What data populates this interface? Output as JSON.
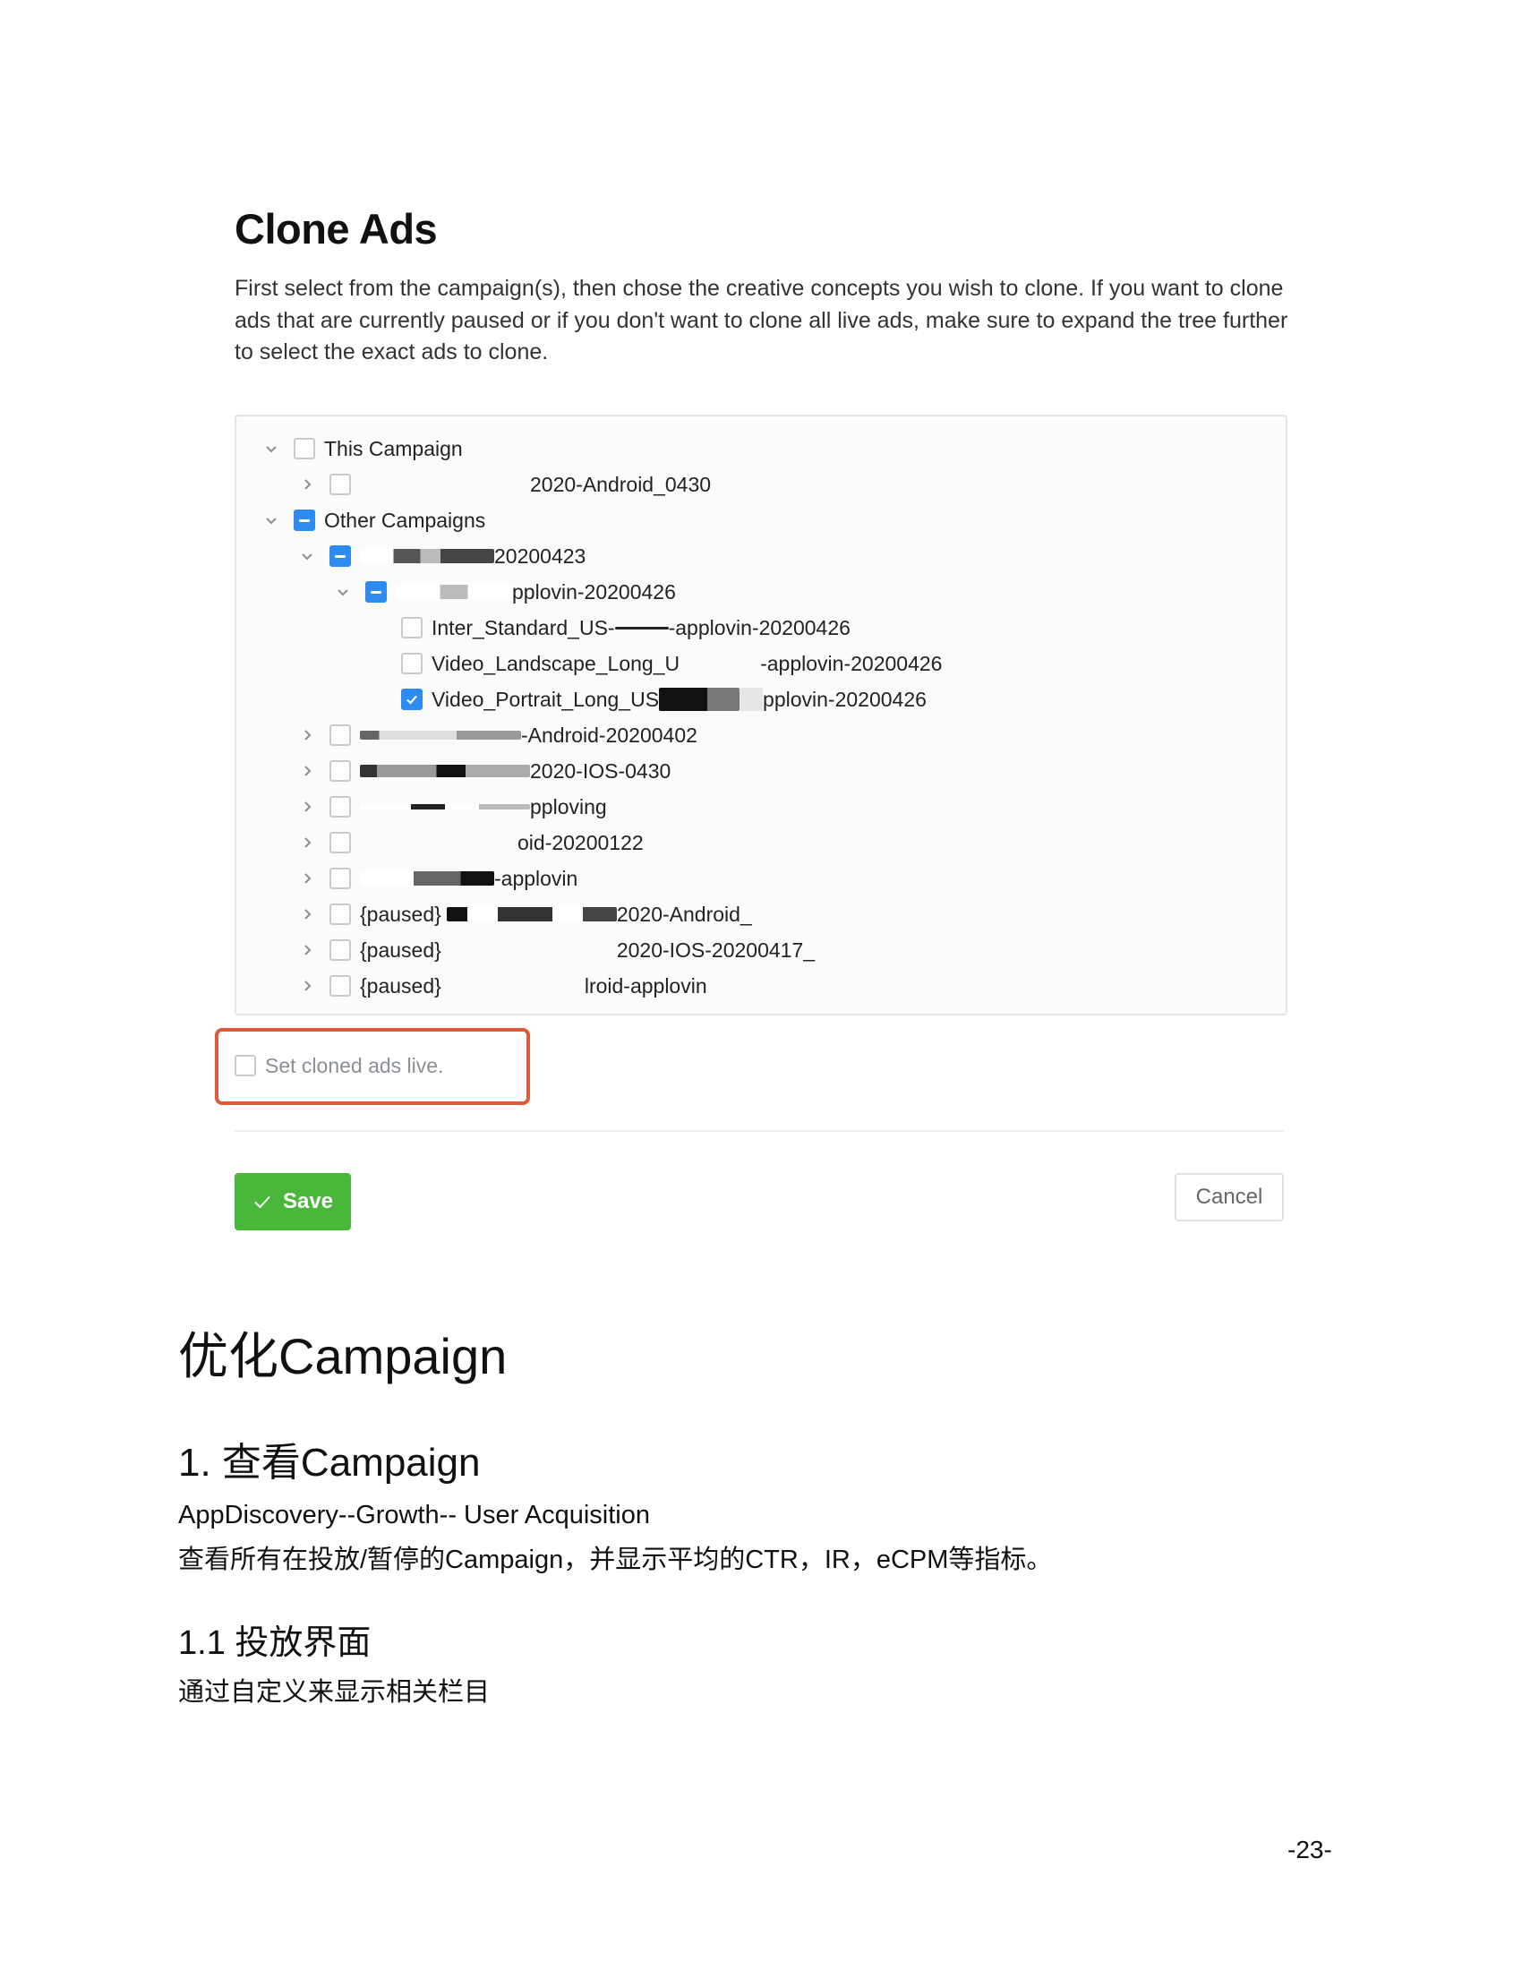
{
  "screenshot": {
    "title": "Clone Ads",
    "description": "First select from the campaign(s), then chose the creative concepts you wish to clone. If you want to clone ads that are currently paused or if you don't want to clone all live ads, make sure to expand the tree further to select the exact ads to clone.",
    "tree": {
      "this_campaign": "This Campaign",
      "this_campaign_child": "2020-Android_0430",
      "other_campaigns": "Other Campaigns",
      "group_1": "20200423",
      "subgroup_1": "pplovin-20200426",
      "ad_1": "Inter_Standard_US-",
      "ad_1_suffix": "-applovin-20200426",
      "ad_2": "Video_Landscape_Long_U",
      "ad_2_suffix": "-applovin-20200426",
      "ad_3": "Video_Portrait_Long_US",
      "ad_3_suffix": "pplovin-20200426",
      "campaign_a": "-Android-20200402",
      "campaign_b": "2020-IOS-0430",
      "campaign_c": "pploving",
      "campaign_d": "oid-20200122",
      "campaign_e": "-applovin",
      "paused_label": "{paused}",
      "campaign_f": "2020-Android_",
      "campaign_g": "2020-IOS-20200417_",
      "campaign_h": "lroid-applovin"
    },
    "set_live_label": "Set cloned ads live.",
    "save_label": "Save",
    "cancel_label": "Cancel"
  },
  "document": {
    "heading_1": "优化Campaign",
    "heading_2": "1. 查看Campaign",
    "path_text": "AppDiscovery--Growth-- User Acquisition",
    "paragraph_1": "查看所有在投放/暂停的Campaign，并显示平均的CTR，IR，eCPM等指标。",
    "heading_3": "1.1 投放界面",
    "paragraph_2": "通过自定义来显示相关栏目",
    "page_number": "-23-"
  },
  "colors": {
    "accent_blue": "#2d8cf0",
    "save_green": "#49b73a",
    "highlight_red": "#e05a3a"
  }
}
